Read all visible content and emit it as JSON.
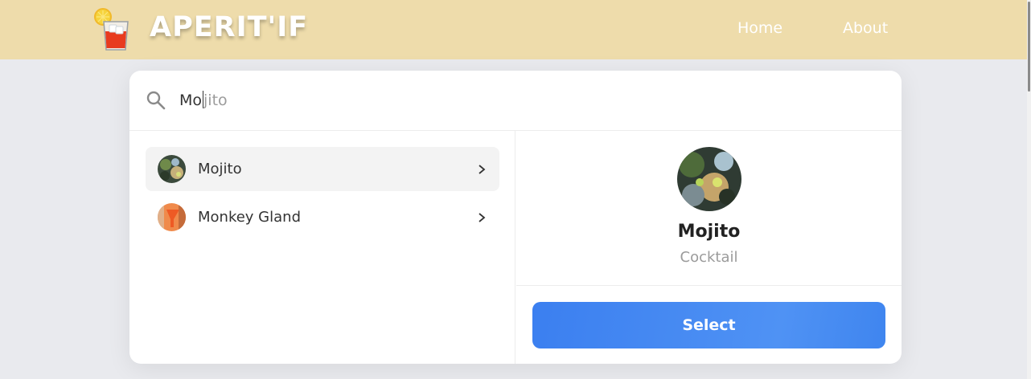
{
  "header": {
    "brand": "APERIT'IF",
    "nav": [
      "Home",
      "About"
    ]
  },
  "search": {
    "typed": "Mo",
    "suggestion_rest": "jito",
    "value": "Mo"
  },
  "results": [
    {
      "label": "Mojito",
      "active": true
    },
    {
      "label": "Monkey Gland",
      "active": false
    }
  ],
  "detail": {
    "name": "Mojito",
    "type": "Cocktail",
    "select_label": "Select"
  },
  "colors": {
    "header_bg": "#eedcab",
    "page_bg": "#e9eaee",
    "accent": "#3b7ff0"
  }
}
